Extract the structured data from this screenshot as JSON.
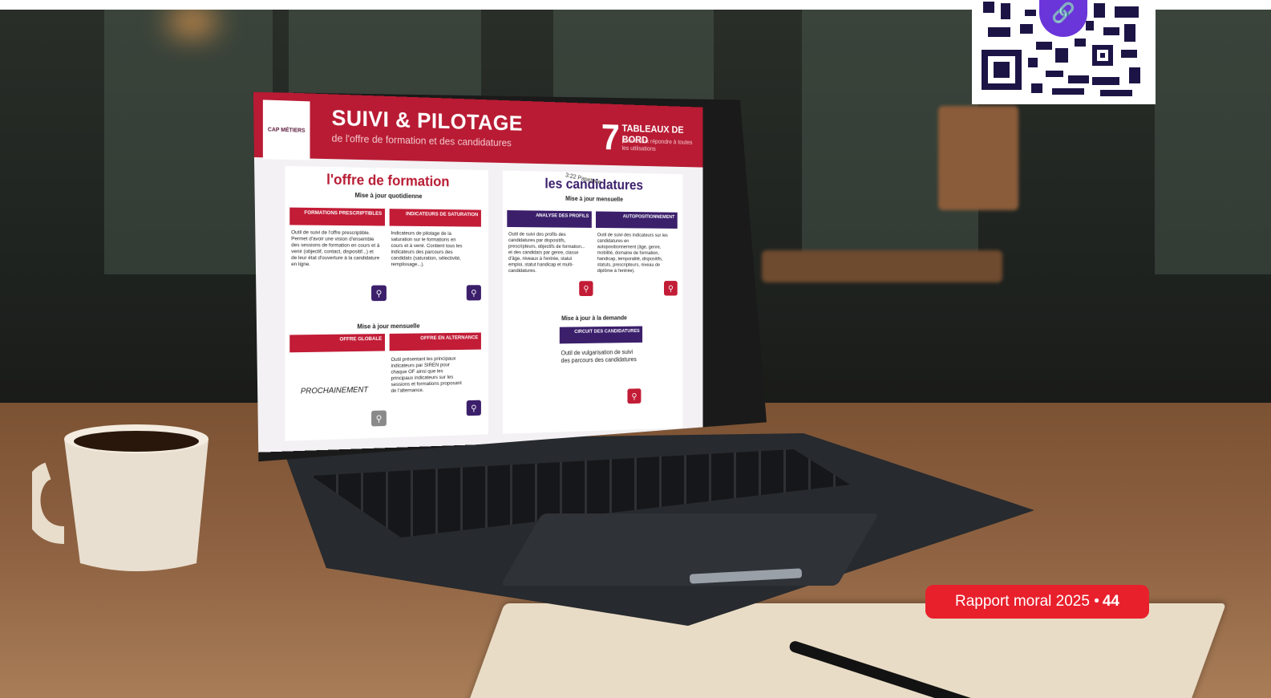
{
  "screen": {
    "logo_text": "CAP MÉTIERS",
    "title": "SUIVI & PILOTAGE",
    "subtitle": "de l'offre de formation et des candidatures",
    "count": "7",
    "dashboards_label": "TABLEAUX DE BORD",
    "dashboards_sub": "pour mieux répondre à toutes les utilisations",
    "left_column": {
      "heading": "l'offre de formation",
      "daily_update": "Mise à jour quotidienne",
      "monthly_update": "Mise à jour mensuelle",
      "cards": [
        {
          "title": "FORMATIONS PRESCRIPTIBLES",
          "text": "Outil de suivi de l'offre prescriptible. Permet d'avoir une vision d'ensemble des sessions de formation en cours et à venir (objectif, contact, dispositif...) et de leur état d'ouverture à la candidature en ligne."
        },
        {
          "title": "INDICATEURS DE SATURATION",
          "text": "Indicateurs de pilotage de la saturation sur le formations en cours et à venir. Contient tous les indicateurs des parcours des candidats (saturation, sélectivité, remplissage...)."
        },
        {
          "title": "OFFRE GLOBALE",
          "text": "PROCHAINEMENT"
        },
        {
          "title": "OFFRE EN ALTERNANCE",
          "text": "Outil présentant les principaux indicateurs par SIREN pour chaque OF ainsi que les principaux indicateurs sur les sessions et formations proposant de l'alternance."
        }
      ]
    },
    "right_column": {
      "heading": "les candidatures",
      "monthly_update": "Mise à jour mensuelle",
      "on_demand_update": "Mise à jour à la demande",
      "cards": [
        {
          "title": "ANALYSE DES PROFILS",
          "text": "Outil de suivi des profils des candidatures par dispositifs, prescripteurs, objectifs de formation... et des candidats par genre, classe d'âge, niveaux à l'entrée, statut emploi, statut handicap et multi-candidatures."
        },
        {
          "title": "AUTOPOSITIONNEMENT",
          "text": "Outil de suivi des indicateurs sur les candidatures en autopositionnement (âge, genre, mobilité, domaine de formation, handicap, temporalité, dispositifs, statuts, prescripteurs, niveau de diplôme à l'entrée)."
        },
        {
          "title": "CIRCUIT DES CANDIDATURES",
          "text": "Outil de vulgarisation de suivi des parcours des candidatures"
        }
      ]
    },
    "paper_note": "3:22 Papeterie"
  },
  "qr_link_icon": "link-icon",
  "badge": {
    "label": "Rapport moral 2025",
    "separator": "•",
    "page": "44"
  },
  "colors": {
    "badge_red": "#e8202c",
    "brand_red": "#b81b33",
    "brand_purple": "#3b1f6b",
    "qr_accent": "#6a35d9"
  }
}
